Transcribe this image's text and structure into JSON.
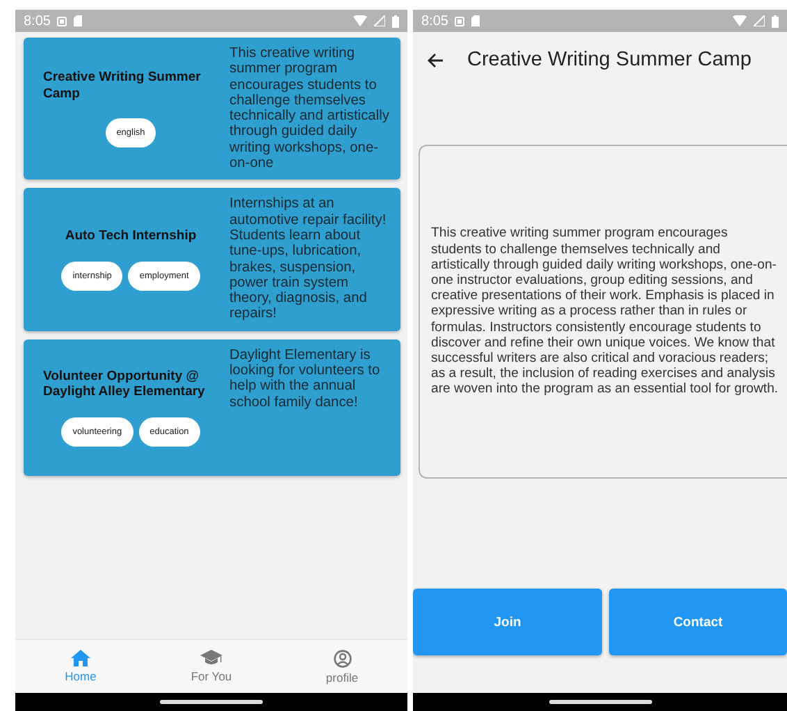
{
  "left": {
    "status_bar": {
      "time": "8:05"
    },
    "cards": [
      {
        "title": "Creative Writing Summer Camp",
        "tags": [
          "english"
        ],
        "description": "This creative writing summer program encourages students to challenge themselves technically and artistically through guided daily writing workshops, one-on-one"
      },
      {
        "title": "Auto Tech Internship",
        "tags": [
          "internship",
          "employment"
        ],
        "description": "Internships at an automotive repair facility! Students learn about tune-ups, lubrication, brakes, suspension, power train system theory, diagnosis, and repairs!"
      },
      {
        "title": "Volunteer Opportunity @ Daylight Alley Elementary",
        "tags": [
          "volunteering",
          "education"
        ],
        "description": "Daylight Elementary is looking for volunteers to help with the annual school family dance!"
      }
    ],
    "bottom_nav": [
      {
        "label": "Home",
        "selected": true
      },
      {
        "label": "For You",
        "selected": false
      },
      {
        "label": "profile",
        "selected": false
      }
    ]
  },
  "right": {
    "status_bar": {
      "time": "8:05"
    },
    "app_bar": {
      "title": "Creative Writing Summer Camp"
    },
    "description": "This creative writing summer program encourages students to challenge themselves technically and artistically through guided daily writing workshops, one-on-one instructor evaluations, group editing sessions, and creative presentations of their work. Emphasis is placed in expressive writing as a process rather than in rules or formulas. Instructors consistently encourage students to discover and refine their own unique voices. We know that successful writers are also critical and voracious readers; as a result, the inclusion of reading exercises and analysis are woven into the program as an essential tool for growth.",
    "buttons": [
      "Join",
      "Contact"
    ]
  }
}
